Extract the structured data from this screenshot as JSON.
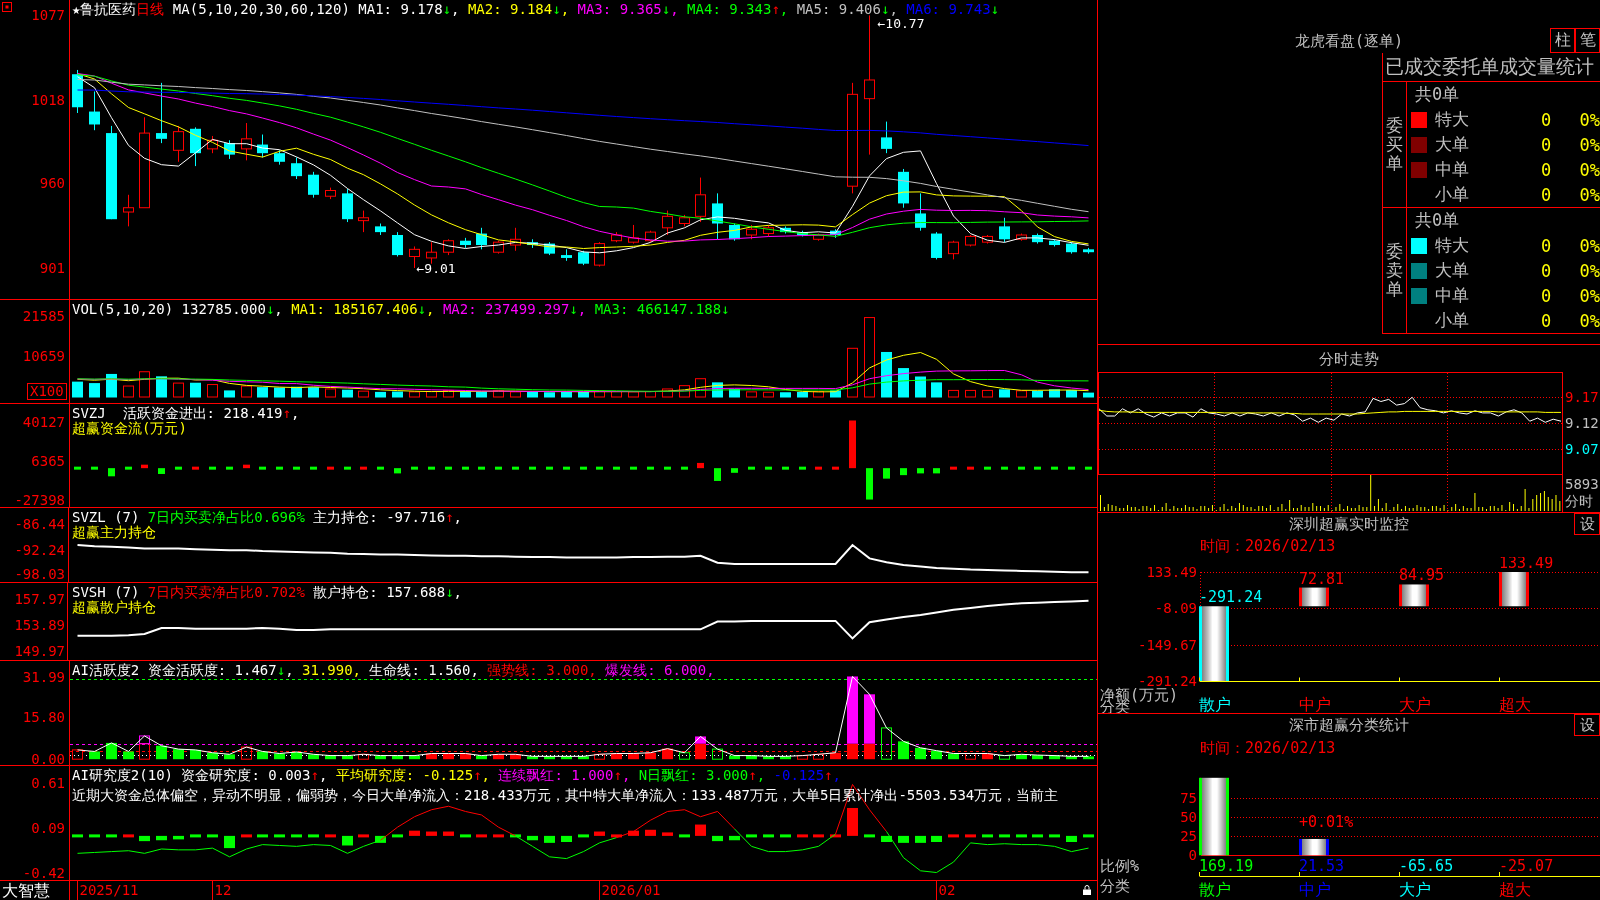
{
  "chart_panels": [
    {
      "kind": "price",
      "legend": [
        {
          "text": "★鲁抗医药",
          "color": "#ffffff"
        },
        {
          "text": "日线",
          "color": "#ff0000"
        },
        {
          "text": " MA(5,10,20,30,60,120) ",
          "color": "#ffffff"
        },
        {
          "text": "MA1: 9.178",
          "color": "#ffffff",
          "arrow": "↓",
          "rising": false,
          "suffix": ","
        },
        {
          "text": " MA2: 9.184",
          "color": "#ffff00",
          "arrow": "↓",
          "rising": false,
          "suffix": ","
        },
        {
          "text": " MA3: 9.365",
          "color": "#ff00ff",
          "arrow": "↓",
          "rising": false,
          "suffix": ","
        },
        {
          "text": " MA4: 9.343",
          "color": "#00ff00",
          "arrow": "↑",
          "rising": true,
          "suffix": ","
        },
        {
          "text": " MA5: 9.406",
          "color": "#c0c0c0",
          "arrow": "↓",
          "rising": false,
          "suffix": ","
        },
        {
          "text": " MA6: 9.743",
          "color": "#0000ff",
          "arrow": "↓",
          "rising": false
        }
      ],
      "y_labels": [
        "1077",
        "1018",
        "960",
        "901"
      ],
      "high_label": "←10.77",
      "low_label": "←9.01"
    },
    {
      "kind": "volume",
      "legend": [
        {
          "text": "VOL(5,10,20) 132785.000",
          "color": "#ffffff",
          "arrow": "↓",
          "rising": false,
          "suffix": ","
        },
        {
          "text": " MA1: 185167.406",
          "color": "#ffff00",
          "arrow": "↓",
          "rising": false,
          "suffix": ","
        },
        {
          "text": " MA2: 237499.297",
          "color": "#ff00ff",
          "arrow": "↓",
          "rising": false,
          "suffix": ","
        },
        {
          "text": " MA3: 466147.188",
          "color": "#00ff00",
          "arrow": "↓",
          "rising": false
        }
      ],
      "y_labels": [
        "21585",
        "10659"
      ],
      "unit_label": "X100"
    },
    {
      "kind": "flow",
      "legend": [
        {
          "text": "SVZJ  活跃资金进出: 218.419",
          "color": "#ffffff",
          "arrow": "↑",
          "rising": true,
          "suffix": ","
        }
      ],
      "subtitle": "超赢资金流(万元)",
      "y_labels": [
        "40127",
        "6365",
        "-27398"
      ]
    },
    {
      "kind": "main_holding",
      "legend": [
        {
          "text": "SVZL (7) ",
          "color": "#ffffff"
        },
        {
          "text": "7日内买卖净占比0.696%",
          "color": "#00ff00"
        },
        {
          "text": " 主力持仓: -97.716",
          "color": "#ffffff",
          "arrow": "↑",
          "rising": true,
          "suffix": ","
        }
      ],
      "subtitle": "超赢主力持仓",
      "chart_data": {
        "type": "line",
        "ylim": [
          -99.77,
          -82.62
        ],
        "yticks": [
          -86.44,
          -92.24,
          -98.03
        ],
        "series": [
          {
            "color": "#ffffff",
            "values": [
              -91.2,
              -91.5,
              -91.6,
              -91.8,
              -92.0,
              -92.0,
              -92.0,
              -92.2,
              -92.3,
              -92.4,
              -92.4,
              -92.6,
              -92.7,
              -92.8,
              -92.9,
              -93.0,
              -93.2,
              -93.3,
              -93.4,
              -93.4,
              -93.5,
              -93.6,
              -93.7,
              -93.7,
              -93.8,
              -93.8,
              -93.9,
              -94.0,
              -94.0,
              -94.1,
              -94.1,
              -94.1,
              -94.1,
              -94.0,
              -94.0,
              -93.9,
              -93.9,
              -93.7,
              -95.3,
              -95.6,
              -95.6,
              -95.6,
              -95.6,
              -95.6,
              -95.6,
              -95.6,
              -91.2,
              -94.3,
              -95.2,
              -95.8,
              -96.2,
              -96.5,
              -96.7,
              -96.9,
              -97.0,
              -97.1,
              -97.2,
              -97.3,
              -97.4,
              -97.5,
              -97.5
            ]
          }
        ]
      }
    },
    {
      "kind": "retail_holding",
      "legend": [
        {
          "text": "SVSH (7) ",
          "color": "#ffffff"
        },
        {
          "text": "7日内买卖净占比0.702%",
          "color": "#ff0000"
        },
        {
          "text": " 散户持仓: 157.688",
          "color": "#ffffff",
          "arrow": "↓",
          "rising": false,
          "suffix": ","
        }
      ],
      "subtitle": "超赢散户持仓",
      "chart_data": {
        "type": "line",
        "ylim": [
          148.58,
          160.43
        ],
        "yticks": [
          157.97,
          153.89,
          149.97
        ],
        "series": [
          {
            "color": "#ffffff",
            "values": [
              152.3,
              152.3,
              152.3,
              152.4,
              152.6,
              153.5,
              153.5,
              153.4,
              153.4,
              153.4,
              153.4,
              153.5,
              153.4,
              153.2,
              153.2,
              153.3,
              153.3,
              153.3,
              153.3,
              153.3,
              153.3,
              153.3,
              153.3,
              153.3,
              153.3,
              153.3,
              153.3,
              153.3,
              153.3,
              153.3,
              153.3,
              153.3,
              153.3,
              153.3,
              153.3,
              153.3,
              153.3,
              153.3,
              154.5,
              154.5,
              154.6,
              154.6,
              154.6,
              154.6,
              154.6,
              154.6,
              151.9,
              154.4,
              154.8,
              155.2,
              155.5,
              155.9,
              156.3,
              156.6,
              156.9,
              157.1,
              157.3,
              157.4,
              157.5,
              157.6,
              157.7
            ]
          }
        ]
      }
    },
    {
      "kind": "activity",
      "legend": [
        {
          "text": "AI活跃度2 资金活跃度: 1.467",
          "color": "#ffffff",
          "arrow": "↓",
          "rising": false,
          "suffix": ","
        },
        {
          "text": " 31.990,",
          "color": "#ffff00"
        },
        {
          "text": " 生命线: 1.560,",
          "color": "#ffffff"
        },
        {
          "text": " 强势线: 3.000,",
          "color": "#ff0000"
        },
        {
          "text": " 爆发线: 6.000,",
          "color": "#ff00ff"
        }
      ],
      "y_labels": [
        "31.99",
        "15.80",
        "0.00"
      ]
    },
    {
      "kind": "research",
      "legend": [
        {
          "text": "AI研究度2(10) 资金研究度: 0.003",
          "color": "#ffffff",
          "arrow": "↑",
          "rising": true,
          "suffix": ","
        },
        {
          "text": " 平均研究度: -0.125",
          "color": "#ffff00",
          "arrow": "↑",
          "rising": true,
          "suffix": ","
        },
        {
          "text": " 连续飘红: 1.000",
          "color": "#ff00ff",
          "arrow": "↑",
          "rising": true,
          "suffix": ","
        },
        {
          "text": " N日飘红: 3.000",
          "color": "#00ff00",
          "arrow": "↑",
          "rising": true,
          "suffix": ","
        },
        {
          "text": " -0.125",
          "color": "#0000ff",
          "arrow": "↑",
          "rising": true,
          "suffix": ","
        }
      ],
      "commentary": "近期大资金总体偏空，异动不明显，偏弱势，今日大单净流入：218.433万元，其中特大单净流入：133.487万元，大单5日累计净出-5503.534万元，当前主",
      "y_labels": [
        "0.61",
        "0.09",
        "-0.42"
      ]
    }
  ],
  "date_axis": {
    "brand": "大智慧",
    "dates": [
      "2025/11",
      "12",
      "2026/01",
      "02"
    ]
  },
  "dragon_tiger": {
    "title": "龙虎看盘(逐单)",
    "buttons": [
      "柱",
      "笔"
    ],
    "table_title": "已成交委托单成交量统计",
    "groups": [
      {
        "label": "委买单",
        "total": "共0单",
        "rows": [
          {
            "name": "特大",
            "count": "0",
            "share": "0%",
            "color": "#ff0000"
          },
          {
            "name": "大单",
            "count": "0",
            "share": "0%",
            "color": "#800000"
          },
          {
            "name": "中单",
            "count": "0",
            "share": "0%",
            "color": "#800000"
          },
          {
            "name": "小单",
            "count": "0",
            "share": "0%"
          }
        ]
      },
      {
        "label": "委卖单",
        "total": "共0单",
        "rows": [
          {
            "name": "特大",
            "count": "0",
            "share": "0%",
            "color": "#00ffff"
          },
          {
            "name": "大单",
            "count": "0",
            "share": "0%",
            "color": "#008080"
          },
          {
            "name": "中单",
            "count": "0",
            "share": "0%",
            "color": "#008080"
          },
          {
            "name": "小单",
            "count": "0",
            "share": "0%"
          }
        ]
      }
    ]
  },
  "intraday": {
    "title": "分时走势",
    "chart_data": {
      "type": "line",
      "ylim": [
        9.0225,
        9.2187
      ],
      "yticks": [
        9.17,
        9.12,
        9.07
      ],
      "grid": true,
      "series": [
        {
          "color": "#ffffff",
          "values": [
            9.148,
            9.134,
            9.134,
            9.148,
            9.14,
            9.148,
            9.138,
            9.132,
            9.14,
            9.134,
            9.14,
            9.14,
            9.132,
            9.148,
            9.14,
            9.138,
            9.134,
            9.14,
            9.134,
            9.14,
            9.138,
            9.134,
            9.14,
            9.134,
            9.14,
            9.136,
            9.124,
            9.13,
            9.122,
            9.13,
            9.126,
            9.138,
            9.134,
            9.14,
            9.142,
            9.168,
            9.162,
            9.166,
            9.155,
            9.158,
            9.17,
            9.15,
            9.146,
            9.144,
            9.14,
            9.144,
            9.14,
            9.138,
            9.144,
            9.14,
            9.14,
            9.134,
            9.142,
            9.146,
            9.14,
            9.124,
            9.13,
            9.122,
            9.128,
            9.124
          ]
        },
        {
          "color": "#ffff00",
          "values": [
            9.145,
            9.143,
            9.142,
            9.142,
            9.142,
            9.141,
            9.141,
            9.141,
            9.141,
            9.141,
            9.141,
            9.141,
            9.141,
            9.141,
            9.141,
            9.141,
            9.14,
            9.14,
            9.14,
            9.14,
            9.14,
            9.14,
            9.14,
            9.14,
            9.139,
            9.139,
            9.138,
            9.138,
            9.138,
            9.138,
            9.138,
            9.138,
            9.138,
            9.138,
            9.139,
            9.14,
            9.141,
            9.142,
            9.142,
            9.143,
            9.143,
            9.143,
            9.143,
            9.143,
            9.143,
            9.143,
            9.143,
            9.143,
            9.143,
            9.143,
            9.143,
            9.142,
            9.142,
            9.142,
            9.142,
            9.142,
            9.142,
            9.141,
            9.141,
            9.141
          ]
        }
      ]
    },
    "volume_label": "5893",
    "volume_caption": "分时"
  },
  "shenzhen_monitor": {
    "title": "深圳超赢实时监控",
    "settings_button": "设",
    "time": "时间：2026/02/13",
    "chart_data": {
      "type": "bar",
      "categories": [
        "散户",
        "中户",
        "大户",
        "超大"
      ],
      "values": [
        -291.24,
        72.81,
        84.95,
        133.49
      ],
      "ylim": [
        -291.24,
        133.49
      ],
      "yticks": [
        133.49,
        -8.09,
        -149.67,
        -291.24
      ],
      "grid": true,
      "ylabel": "净额(万元)",
      "xlabel": "分类",
      "data_labels": true
    }
  },
  "shenzhen_stats": {
    "title": "深市超赢分类统计",
    "settings_button": "设",
    "time": "时间：2026/02/13",
    "amounts": [
      "169.19",
      "21.53",
      "-65.65",
      "-25.07"
    ],
    "chart_data": {
      "type": "bar",
      "categories": [
        "散户",
        "中户",
        "大户",
        "超大"
      ],
      "values": [
        102,
        21.5,
        null,
        null
      ],
      "colors": [
        "#00ff00",
        "#0000ff",
        "#00ffff",
        "#ff0000"
      ],
      "ylim": [
        0,
        102
      ],
      "yticks": [
        0,
        25,
        50,
        75
      ],
      "grid": true,
      "ylabel": "比例%",
      "xlabel": "分类",
      "annotations": [
        {
          "x": "中户",
          "y": 21.5,
          "text": "+0.01%"
        }
      ]
    }
  }
}
